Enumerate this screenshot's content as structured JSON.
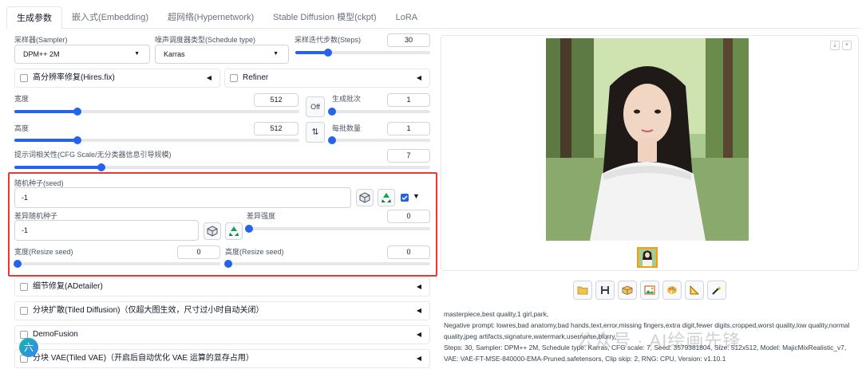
{
  "tabs": [
    {
      "label": "生成参数",
      "active": true
    },
    {
      "label": "嵌入式(Embedding)"
    },
    {
      "label": "超网络(Hypernetwork)"
    },
    {
      "label": "Stable Diffusion 模型(ckpt)"
    },
    {
      "label": "LoRA"
    }
  ],
  "sampler": {
    "label": "采样器(Sampler)",
    "value": "DPM++ 2M"
  },
  "schedule": {
    "label": "噪声调度器类型(Schedule type)",
    "value": "Karras"
  },
  "steps": {
    "label": "采样迭代步数(Steps)",
    "value": "30",
    "fraction": 0.24
  },
  "hires": {
    "label": "高分辨率修复(Hires.fix)"
  },
  "refiner": {
    "label": "Refiner"
  },
  "width": {
    "label": "宽度",
    "value": "512",
    "fraction": 0.22
  },
  "height": {
    "label": "高度",
    "value": "512",
    "fraction": 0.22
  },
  "swap_off": "Off",
  "batch_count": {
    "label": "生成批次",
    "value": "1",
    "fraction": 0.0
  },
  "batch_size": {
    "label": "每批数量",
    "value": "1",
    "fraction": 0.0
  },
  "cfg": {
    "label": "提示词相关性(CFG Scale/无分类器信息引导规模)",
    "value": "7",
    "fraction": 0.21
  },
  "seed": {
    "label": "随机种子(seed)",
    "value": "-1"
  },
  "variation_seed": {
    "label": "差异随机种子",
    "value": "-1"
  },
  "variation_strength": {
    "label": "差异强度",
    "value": "0",
    "fraction": 0.0
  },
  "resize_w": {
    "label": "宽度(Resize seed)",
    "value": "0",
    "fraction": 0.0
  },
  "resize_h": {
    "label": "高度(Resize seed)",
    "value": "0",
    "fraction": 0.0
  },
  "accordions": [
    {
      "label": "细节修复(ADetailer)"
    },
    {
      "label": "分块扩散(Tiled Diffusion)（仅超大图生效，尺寸过小时自动关闭）"
    },
    {
      "label": "DemoFusion"
    },
    {
      "label": "分块 VAE(Tiled VAE)（开启后自动优化 VAE 运算的显存占用）"
    }
  ],
  "info": {
    "prompt": "masterpiece,best quality,1 girl,park,",
    "negative": "Negative prompt: lowres,bad anatomy,bad hands,text,error,missing fingers,extra digit,fewer digits,cropped,worst quality,low quality,normal quality,jpeg artifacts,signature,watermark,username,blurry,",
    "params": "Steps: 30, Sampler: DPM++ 2M, Schedule type: Karras, CFG scale: 7, Seed: 3579381804, Size: 512x512, Model: MajicMixRealistic_v7, VAE: VAE-FT-MSE-840000-EMA-Pruned.safetensors, Clip skip: 2, RNG: CPU, Version: v1.10.1"
  },
  "watermark": "公众号 · AI绘画先锋",
  "badge": "六",
  "colors": {
    "accent": "#2563eb",
    "highlight": "#e53935"
  }
}
